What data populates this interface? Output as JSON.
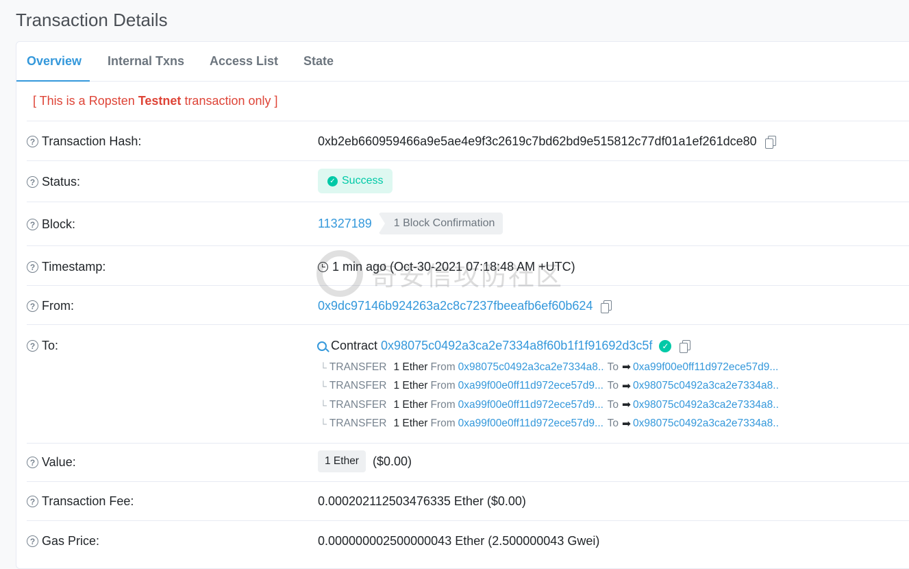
{
  "page_title": "Transaction Details",
  "tabs": [
    {
      "label": "Overview",
      "active": true
    },
    {
      "label": "Internal Txns",
      "active": false
    },
    {
      "label": "Access List",
      "active": false
    },
    {
      "label": "State",
      "active": false
    }
  ],
  "notice": {
    "prefix": "[ This is a Ropsten ",
    "bold": "Testnet",
    "suffix": " transaction only ]"
  },
  "rows": {
    "hash": {
      "label": "Transaction Hash:",
      "value": "0xb2eb660959466a9e5ae4e9f3c2619c7bd62bd9e515812c77df01a1ef261dce80"
    },
    "status": {
      "label": "Status:",
      "value": "Success"
    },
    "block": {
      "label": "Block:",
      "value": "11327189",
      "confirmations": "1 Block Confirmation"
    },
    "timestamp": {
      "label": "Timestamp:",
      "value": "1 min ago (Oct-30-2021 07:18:48 AM +UTC)"
    },
    "from": {
      "label": "From:",
      "value": "0x9dc97146b924263a2c8c7237fbeeafb6ef60b624"
    },
    "to": {
      "label": "To:",
      "contract_label": "Contract",
      "contract_address": "0x98075c0492a3ca2e7334a8f60b1f1f91692d3c5f",
      "transfers": [
        {
          "type": "TRANSFER",
          "amount": "1 Ether",
          "from_label": "From",
          "from": "0x98075c0492a3ca2e7334a8...",
          "to_label": "To",
          "to": "0xa99f00e0ff11d972ece57d9..."
        },
        {
          "type": "TRANSFER",
          "amount": "1 Ether",
          "from_label": "From",
          "from": "0xa99f00e0ff11d972ece57d9...",
          "to_label": "To",
          "to": "0x98075c0492a3ca2e7334a8..."
        },
        {
          "type": "TRANSFER",
          "amount": "1 Ether",
          "from_label": "From",
          "from": "0xa99f00e0ff11d972ece57d9...",
          "to_label": "To",
          "to": "0x98075c0492a3ca2e7334a8..."
        },
        {
          "type": "TRANSFER",
          "amount": "1 Ether",
          "from_label": "From",
          "from": "0xa99f00e0ff11d972ece57d9...",
          "to_label": "To",
          "to": "0x98075c0492a3ca2e7334a8..."
        }
      ]
    },
    "value": {
      "label": "Value:",
      "amount": "1 Ether",
      "usd": "($0.00)"
    },
    "fee": {
      "label": "Transaction Fee:",
      "value": "0.000202112503476335 Ether ($0.00)"
    },
    "gas": {
      "label": "Gas Price:",
      "value": "0.000000002500000043 Ether (2.500000043 Gwei)"
    }
  },
  "watermark": "奇安信攻防社区",
  "colors": {
    "link": "#3498db",
    "success": "#00c9a7",
    "danger": "#de4437"
  }
}
